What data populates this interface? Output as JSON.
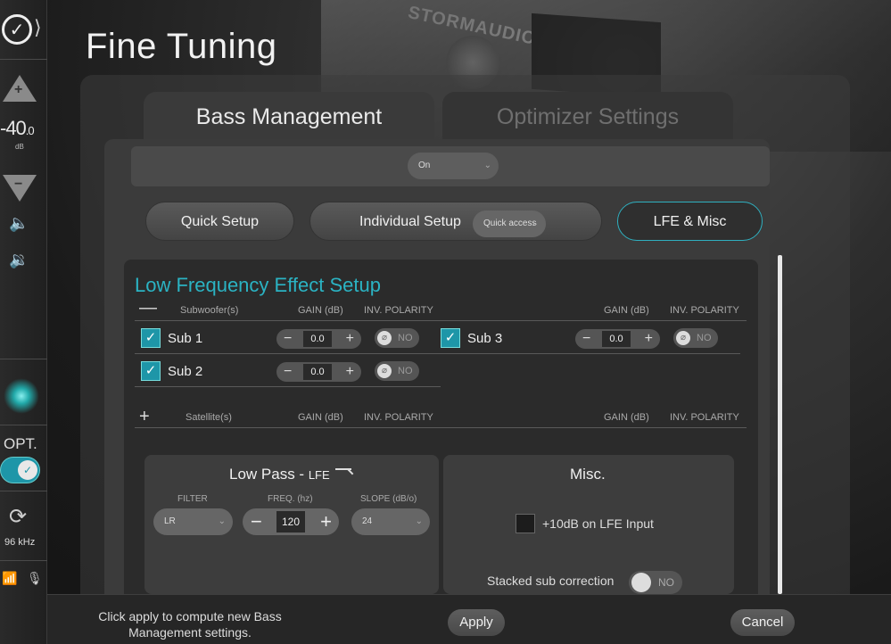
{
  "page": {
    "title": "Fine Tuning"
  },
  "rail": {
    "volume_value": "-40",
    "volume_decimal": ".0",
    "volume_unit": "dB",
    "opt_label": "OPT.",
    "sample_rate": "96 kHz",
    "icons": [
      "logo-icon",
      "chevron-right-icon",
      "volume-up-icon",
      "volume-down-icon",
      "mute-icon",
      "speaker-down-icon",
      "input-cable-icon",
      "opt-toggle",
      "sync-icon",
      "wifi-icon",
      "mic-icon"
    ],
    "accent": "#1e96a8"
  },
  "tabs": [
    {
      "label": "Bass Management",
      "active": true
    },
    {
      "label": "Optimizer Settings",
      "active": false
    }
  ],
  "top_strip": {
    "select_value": "On"
  },
  "sub_tabs": {
    "quick_setup": "Quick Setup",
    "individual_setup": "Individual Setup",
    "individual_select": "Quick access",
    "lfe_misc": "LFE & Misc"
  },
  "lfe": {
    "title": "Low Frequency Effect Setup",
    "subwoofers_header": {
      "toggle": "—",
      "label": "Subwoofer(s)",
      "gain": "GAIN (dB)",
      "polarity": "INV. POLARITY",
      "gain2": "GAIN (dB)",
      "polarity2": "INV. POLARITY"
    },
    "subwoofers": [
      {
        "name": "Sub 1",
        "gain": "0.0",
        "polarity": "NO"
      },
      {
        "name": "Sub 2",
        "gain": "0.0",
        "polarity": "NO"
      },
      {
        "name": "Sub 3",
        "gain": "0.0",
        "polarity": "NO"
      }
    ],
    "satellites_header": {
      "toggle": "+",
      "label": "Satellite(s)",
      "gain": "GAIN (dB)",
      "polarity": "INV. POLARITY",
      "gain2": "GAIN (dB)",
      "polarity2": "INV. POLARITY"
    }
  },
  "low_pass": {
    "title": "Low Pass - ",
    "title_suffix": "LFE",
    "filter_label": "FILTER",
    "filter_value": "LR",
    "freq_label": "FREQ. (hz)",
    "freq_value": "120",
    "slope_label": "SLOPE (dB/o)",
    "slope_value": "24"
  },
  "misc": {
    "title": "Misc.",
    "lfe_input_label": "+10dB on LFE Input",
    "stacked_label": "Stacked sub correction",
    "stacked_value": "NO"
  },
  "footer": {
    "message": "Click apply to compute new Bass Management settings.",
    "apply": "Apply",
    "cancel": "Cancel"
  }
}
